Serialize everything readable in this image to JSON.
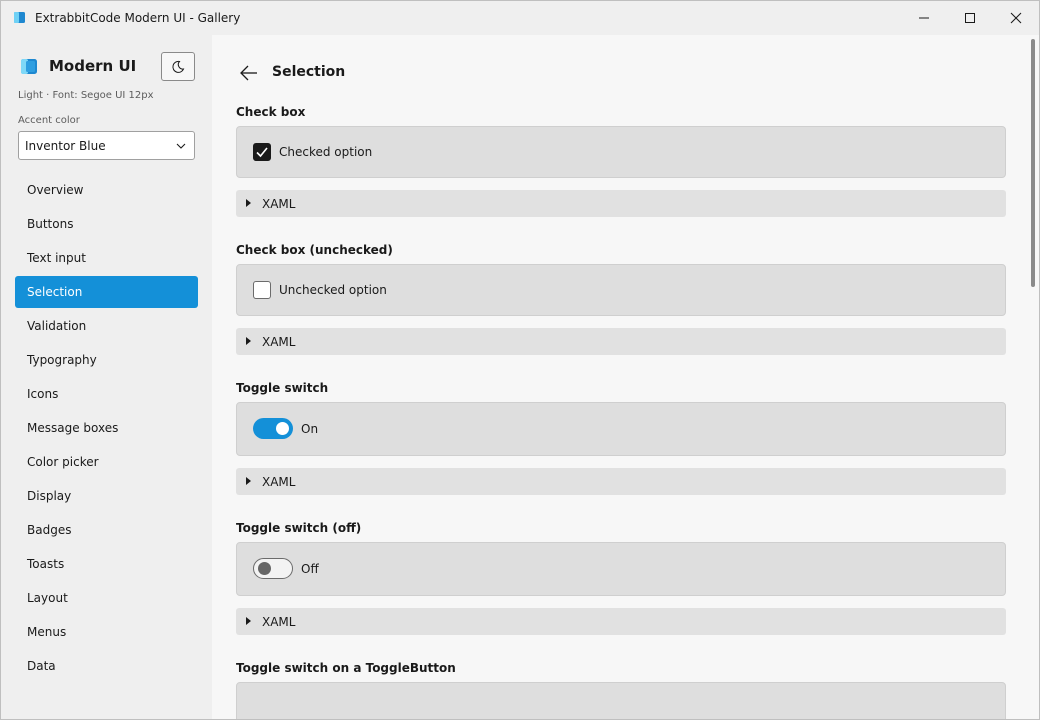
{
  "window": {
    "title": "ExtrabbitCode Modern UI - Gallery",
    "controls": {
      "minimize": "minimize-icon",
      "maximize": "maximize-icon",
      "close": "close-icon"
    }
  },
  "sidebar": {
    "brand": "Modern UI",
    "theme_info": "Light  ·  Font: Segoe UI 12px",
    "accent_label": "Accent color",
    "accent_value": "Inventor Blue",
    "items": [
      {
        "label": "Overview",
        "active": false
      },
      {
        "label": "Buttons",
        "active": false
      },
      {
        "label": "Text input",
        "active": false
      },
      {
        "label": "Selection",
        "active": true
      },
      {
        "label": "Validation",
        "active": false
      },
      {
        "label": "Typography",
        "active": false
      },
      {
        "label": "Icons",
        "active": false
      },
      {
        "label": "Message boxes",
        "active": false
      },
      {
        "label": "Color picker",
        "active": false
      },
      {
        "label": "Display",
        "active": false
      },
      {
        "label": "Badges",
        "active": false
      },
      {
        "label": "Toasts",
        "active": false
      },
      {
        "label": "Layout",
        "active": false
      },
      {
        "label": "Menus",
        "active": false
      },
      {
        "label": "Data",
        "active": false
      }
    ]
  },
  "main": {
    "title": "Selection",
    "sections": [
      {
        "title": "Check box",
        "control": "checkbox",
        "checked": true,
        "label": "Checked option",
        "xaml": "XAML"
      },
      {
        "title": "Check box (unchecked)",
        "control": "checkbox",
        "checked": false,
        "label": "Unchecked option",
        "xaml": "XAML"
      },
      {
        "title": "Toggle switch",
        "control": "toggle",
        "checked": true,
        "label": "On",
        "xaml": "XAML"
      },
      {
        "title": "Toggle switch (off)",
        "control": "toggle",
        "checked": false,
        "label": "Off",
        "xaml": "XAML"
      },
      {
        "title": "Toggle switch on a ToggleButton"
      }
    ]
  },
  "colors": {
    "accent": "#1490d8",
    "sidebar_bg": "#efefef",
    "content_bg": "#f7f7f7",
    "card_bg": "#dedede"
  }
}
